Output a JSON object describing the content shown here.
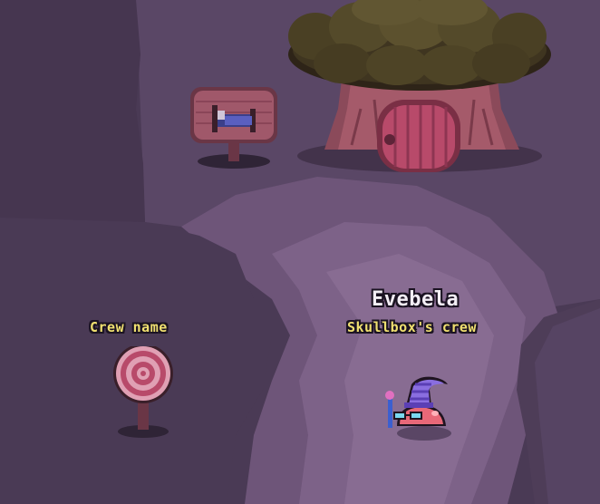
{
  "player": {
    "name": "Evebela",
    "crew": "Skullbox's crew"
  },
  "crew_sign": {
    "label": "Crew name"
  },
  "colors": {
    "ground_dark": "#4a3a55",
    "ground_mid": "#5e4a6b",
    "ground_light": "#7a5f86",
    "path_light": "#8c6d95",
    "name_color": "#f3eef5",
    "crew_color": "#f0e070",
    "label_color": "#f0e070"
  },
  "icons": {
    "sign_icon": "bed-icon",
    "tree": "tree-house-icon",
    "crew_post": "target-sign-icon",
    "avatar": "slime-wizard-icon"
  }
}
